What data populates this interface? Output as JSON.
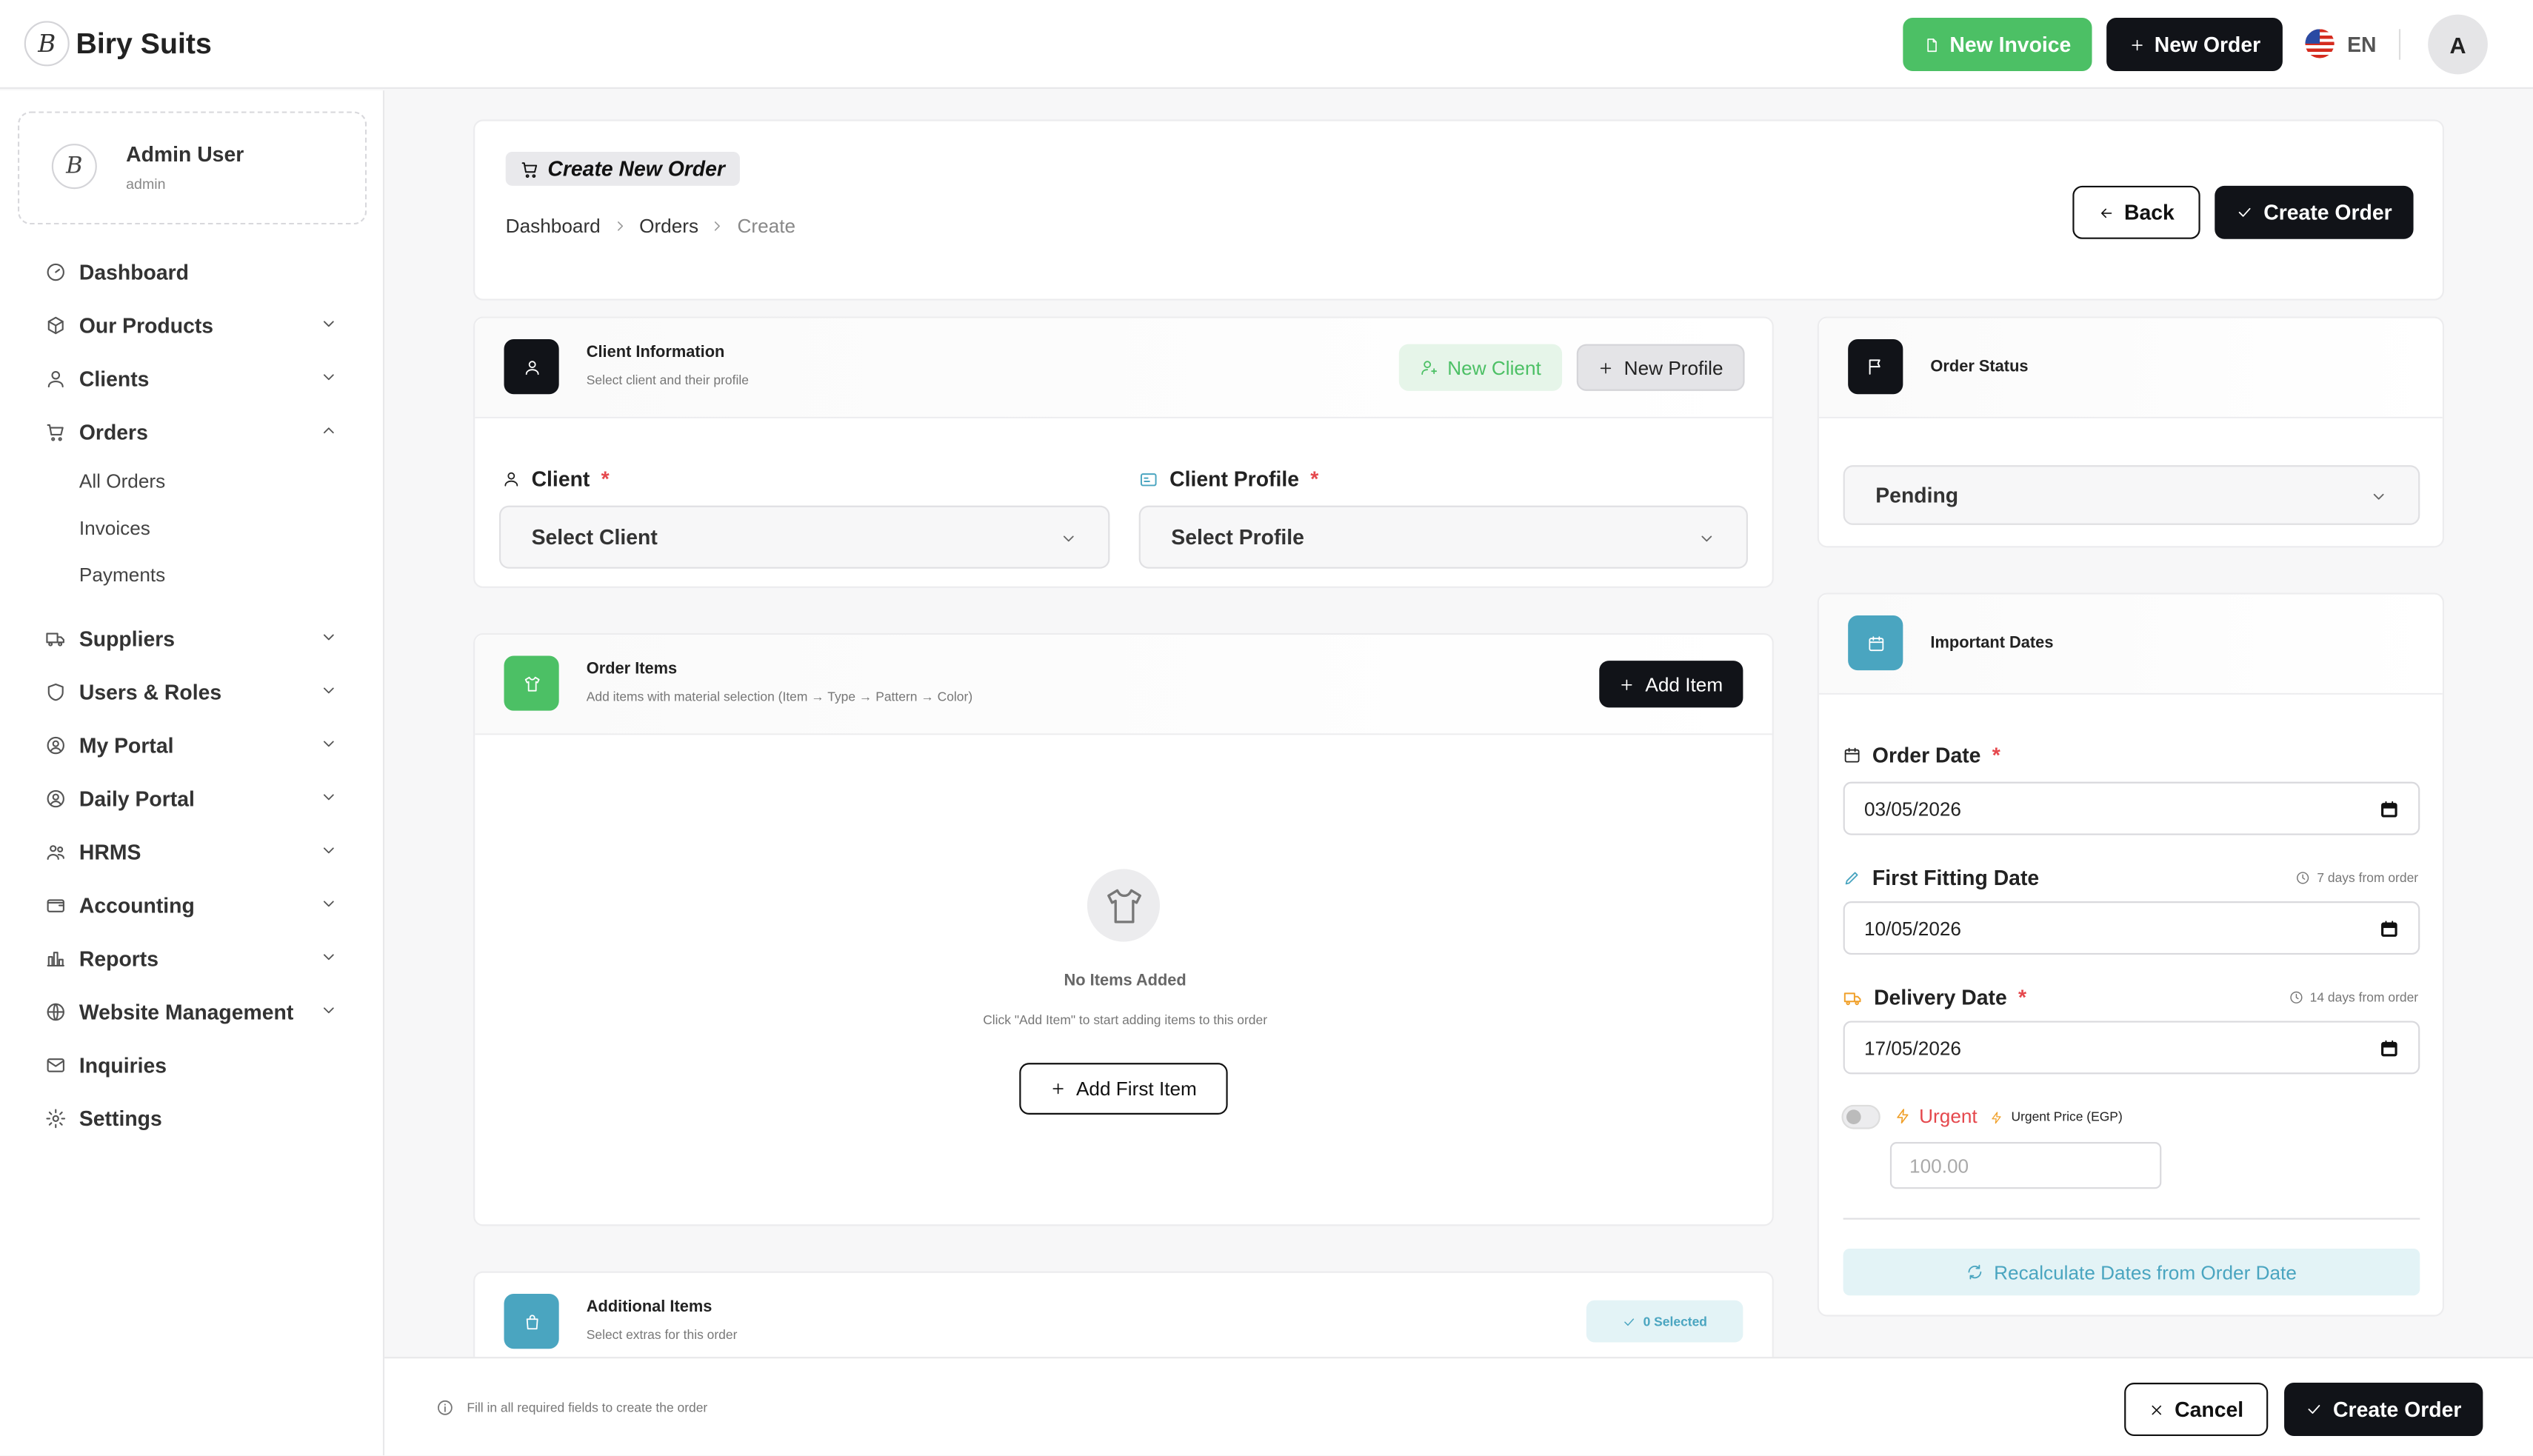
{
  "app": {
    "name": "Biry Suits",
    "logo_letter": "B"
  },
  "header": {
    "new_invoice_label": "New Invoice",
    "new_order_label": "New Order",
    "language": "EN",
    "avatar_letter": "A"
  },
  "sidebar": {
    "user": {
      "name": "Admin User",
      "role": "admin",
      "avatar_letter": "B"
    },
    "items": [
      {
        "label": "Dashboard",
        "icon": "gauge-icon"
      },
      {
        "label": "Our Products",
        "icon": "box-icon"
      },
      {
        "label": "Clients",
        "icon": "user-icon"
      },
      {
        "label": "Orders",
        "icon": "cart-icon"
      },
      {
        "label": "Suppliers",
        "icon": "truck-icon"
      },
      {
        "label": "Users & Roles",
        "icon": "shield-icon"
      },
      {
        "label": "My Portal",
        "icon": "user-circle-icon"
      },
      {
        "label": "Daily Portal",
        "icon": "user-circle-icon"
      },
      {
        "label": "HRMS",
        "icon": "users-icon"
      },
      {
        "label": "Accounting",
        "icon": "wallet-icon"
      },
      {
        "label": "Reports",
        "icon": "bar-chart-icon"
      },
      {
        "label": "Website Management",
        "icon": "globe-icon"
      },
      {
        "label": "Inquiries",
        "icon": "mail-icon"
      },
      {
        "label": "Settings",
        "icon": "gear-icon"
      }
    ],
    "orders_sub": [
      "All Orders",
      "Invoices",
      "Payments"
    ]
  },
  "page": {
    "title": "Create New Order",
    "breadcrumbs": [
      "Dashboard",
      "Orders",
      "Create"
    ],
    "back_label": "Back",
    "create_label": "Create Order"
  },
  "client_info": {
    "title": "Client Information",
    "subtitle": "Select client and their profile",
    "new_client_label": "New Client",
    "new_profile_label": "New Profile",
    "client_label": "Client",
    "client_placeholder": "Select Client",
    "profile_label": "Client Profile",
    "profile_placeholder": "Select Profile",
    "required_mark": "*"
  },
  "order_items": {
    "title": "Order Items",
    "subtitle": "Add items with material selection (Item → Type → Pattern → Color)",
    "add_item_label": "Add Item",
    "empty_title": "No Items Added",
    "empty_subtitle": "Click \"Add Item\" to start adding items to this order",
    "add_first_label": "Add First Item"
  },
  "additional_items": {
    "title": "Additional Items",
    "subtitle": "Select extras for this order",
    "selected_label": "0 Selected"
  },
  "order_status": {
    "title": "Order Status",
    "value": "Pending"
  },
  "dates": {
    "title": "Important Dates",
    "order_date_label": "Order Date",
    "order_date_value": "03/05/2026",
    "first_fitting_label": "First Fitting Date",
    "first_fitting_hint": "7 days from order",
    "first_fitting_value": "10/05/2026",
    "delivery_label": "Delivery Date",
    "delivery_hint": "14 days from order",
    "delivery_value": "17/05/2026",
    "urgent_label": "Urgent",
    "urgent_price_label": "Urgent Price (EGP)",
    "urgent_price_placeholder": "100.00",
    "urgent_enabled": false,
    "recalc_label": "Recalculate Dates from Order Date"
  },
  "footer": {
    "note": "Fill in all required fields to create the order",
    "cancel_label": "Cancel",
    "create_label": "Create Order"
  },
  "colors": {
    "primary_dark": "#111318",
    "green": "#4cc065",
    "teal": "#4aa5c0",
    "required": "#e5484d",
    "orange": "#f0a02a"
  }
}
